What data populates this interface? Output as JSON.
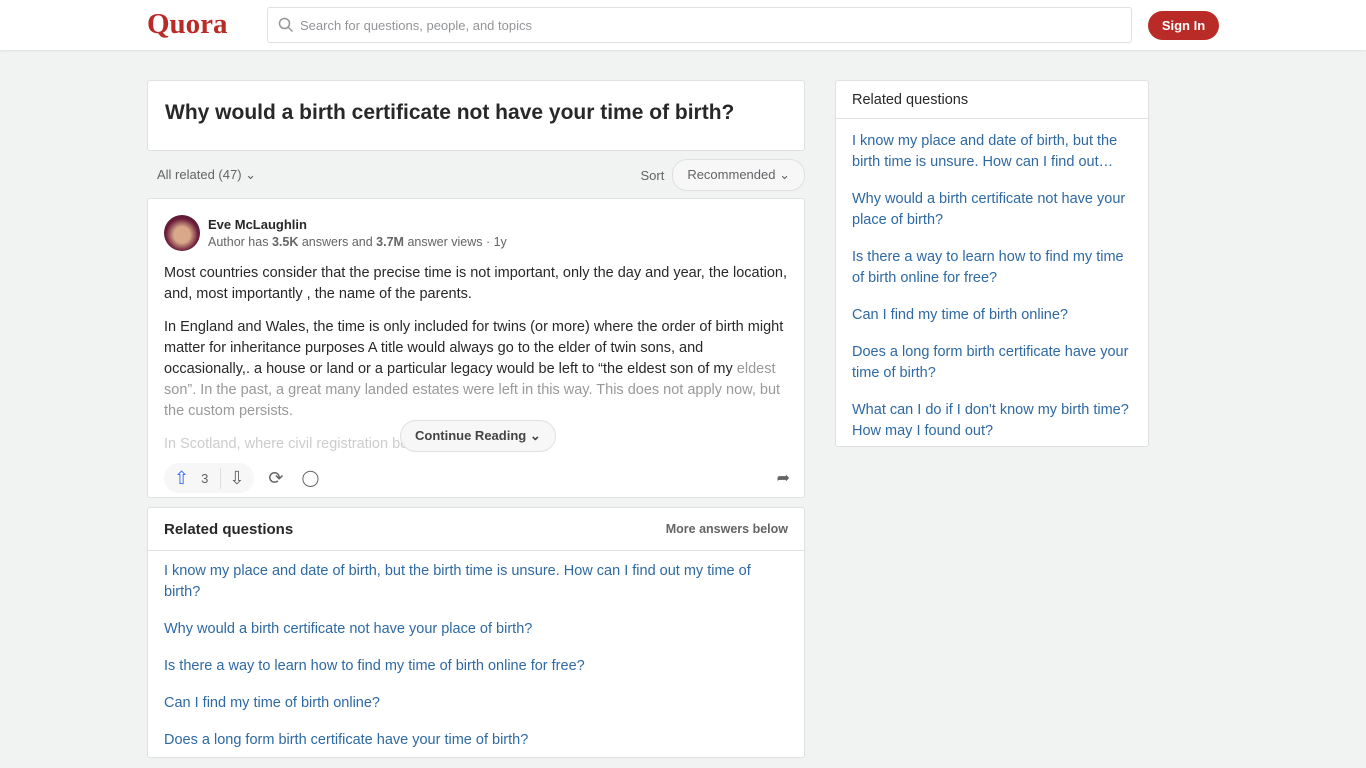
{
  "header": {
    "logo": "Quora",
    "search_placeholder": "Search for questions, people, and topics",
    "signin": "Sign In"
  },
  "question": {
    "title": "Why would a birth certificate not have your time of birth?"
  },
  "filter": {
    "all_related": "All related (47)",
    "sort_label": "Sort",
    "sort_value": "Recommended"
  },
  "answer": {
    "author": "Eve McLaughlin",
    "meta_prefix": "Author has ",
    "answers": "3.5K",
    "meta_mid": " answers and ",
    "views": "3.7M",
    "meta_suffix": " answer views · 1y",
    "paragraphs": [
      "Most countries consider that the precise time is not important, only the day and year, the location, and, most importantly , the name of the parents.",
      "In England and Wales, the time is only included for twins (or more) where the order of birth might matter for inheritance purposes A title would always go to the elder of twin sons, and occasionally,. a house or land or a particular legacy would be left to “the eldest son of my ",
      "eldest son”. In the past, a great many landed estates were left in this way. This does not apply now, but the custom persists.",
      "In Scotland, where civil registration began in"
    ],
    "continue": "Continue Reading",
    "upvotes": "3"
  },
  "related_main": {
    "title": "Related questions",
    "more": "More answers below",
    "items": [
      "I know my place and date of birth, but the birth time is unsure. How can I find out my time of birth?",
      "Why would a birth certificate not have your place of birth?",
      "Is there a way to learn how to find my time of birth online for free?",
      "Can I find my time of birth online?",
      "Does a long form birth certificate have your time of birth?"
    ]
  },
  "related_side": {
    "title": "Related questions",
    "items": [
      "I know my place and date of birth, but the birth time is unsure. How can I find out…",
      "Why would a birth certificate not have your place of birth?",
      "Is there a way to learn how to find my time of birth online for free?",
      "Can I find my time of birth online?",
      "Does a long form birth certificate have your time of birth?",
      "What can I do if I don't know my birth time? How may I found out?"
    ]
  }
}
